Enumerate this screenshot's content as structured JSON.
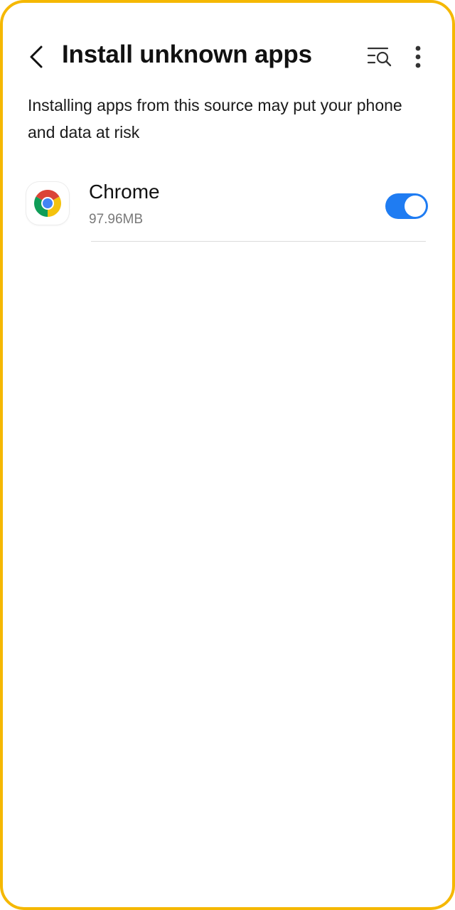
{
  "header": {
    "title": "Install unknown apps",
    "back_icon": "chevron-left-icon",
    "search_icon": "list-search-icon",
    "more_icon": "more-vertical-icon"
  },
  "description": "Installing apps from this source may put your phone and data at risk",
  "apps": [
    {
      "name": "Chrome",
      "size": "97.96MB",
      "icon": "chrome-icon",
      "allowed": true
    }
  ],
  "colors": {
    "frame_border": "#f5b800",
    "toggle_on": "#1f7cf2"
  }
}
